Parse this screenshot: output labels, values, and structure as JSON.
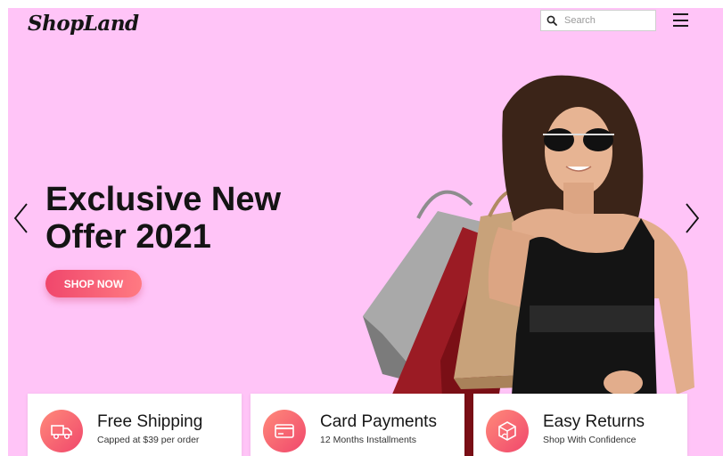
{
  "header": {
    "logo": "ShopLand",
    "search_placeholder": "Search",
    "search_value": ""
  },
  "hero": {
    "headline_line1": "Exclusive New",
    "headline_line2": "Offer 2021",
    "cta_label": "SHOP NOW",
    "background_color": "#ffc4f7",
    "cta_gradient": [
      "#f0476c",
      "#ff7a82"
    ]
  },
  "features": [
    {
      "title": "Free Shipping",
      "subtitle": "Capped at $39 per order",
      "icon": "truck-icon"
    },
    {
      "title": "Card Payments",
      "subtitle": "12 Months Installments",
      "icon": "credit-card-icon"
    },
    {
      "title": "Easy Returns",
      "subtitle": "Shop With Confidence",
      "icon": "return-box-icon"
    }
  ],
  "icons": {
    "search": "search-icon",
    "menu": "hamburger-menu-icon",
    "prev": "chevron-left-icon",
    "next": "chevron-right-icon"
  }
}
